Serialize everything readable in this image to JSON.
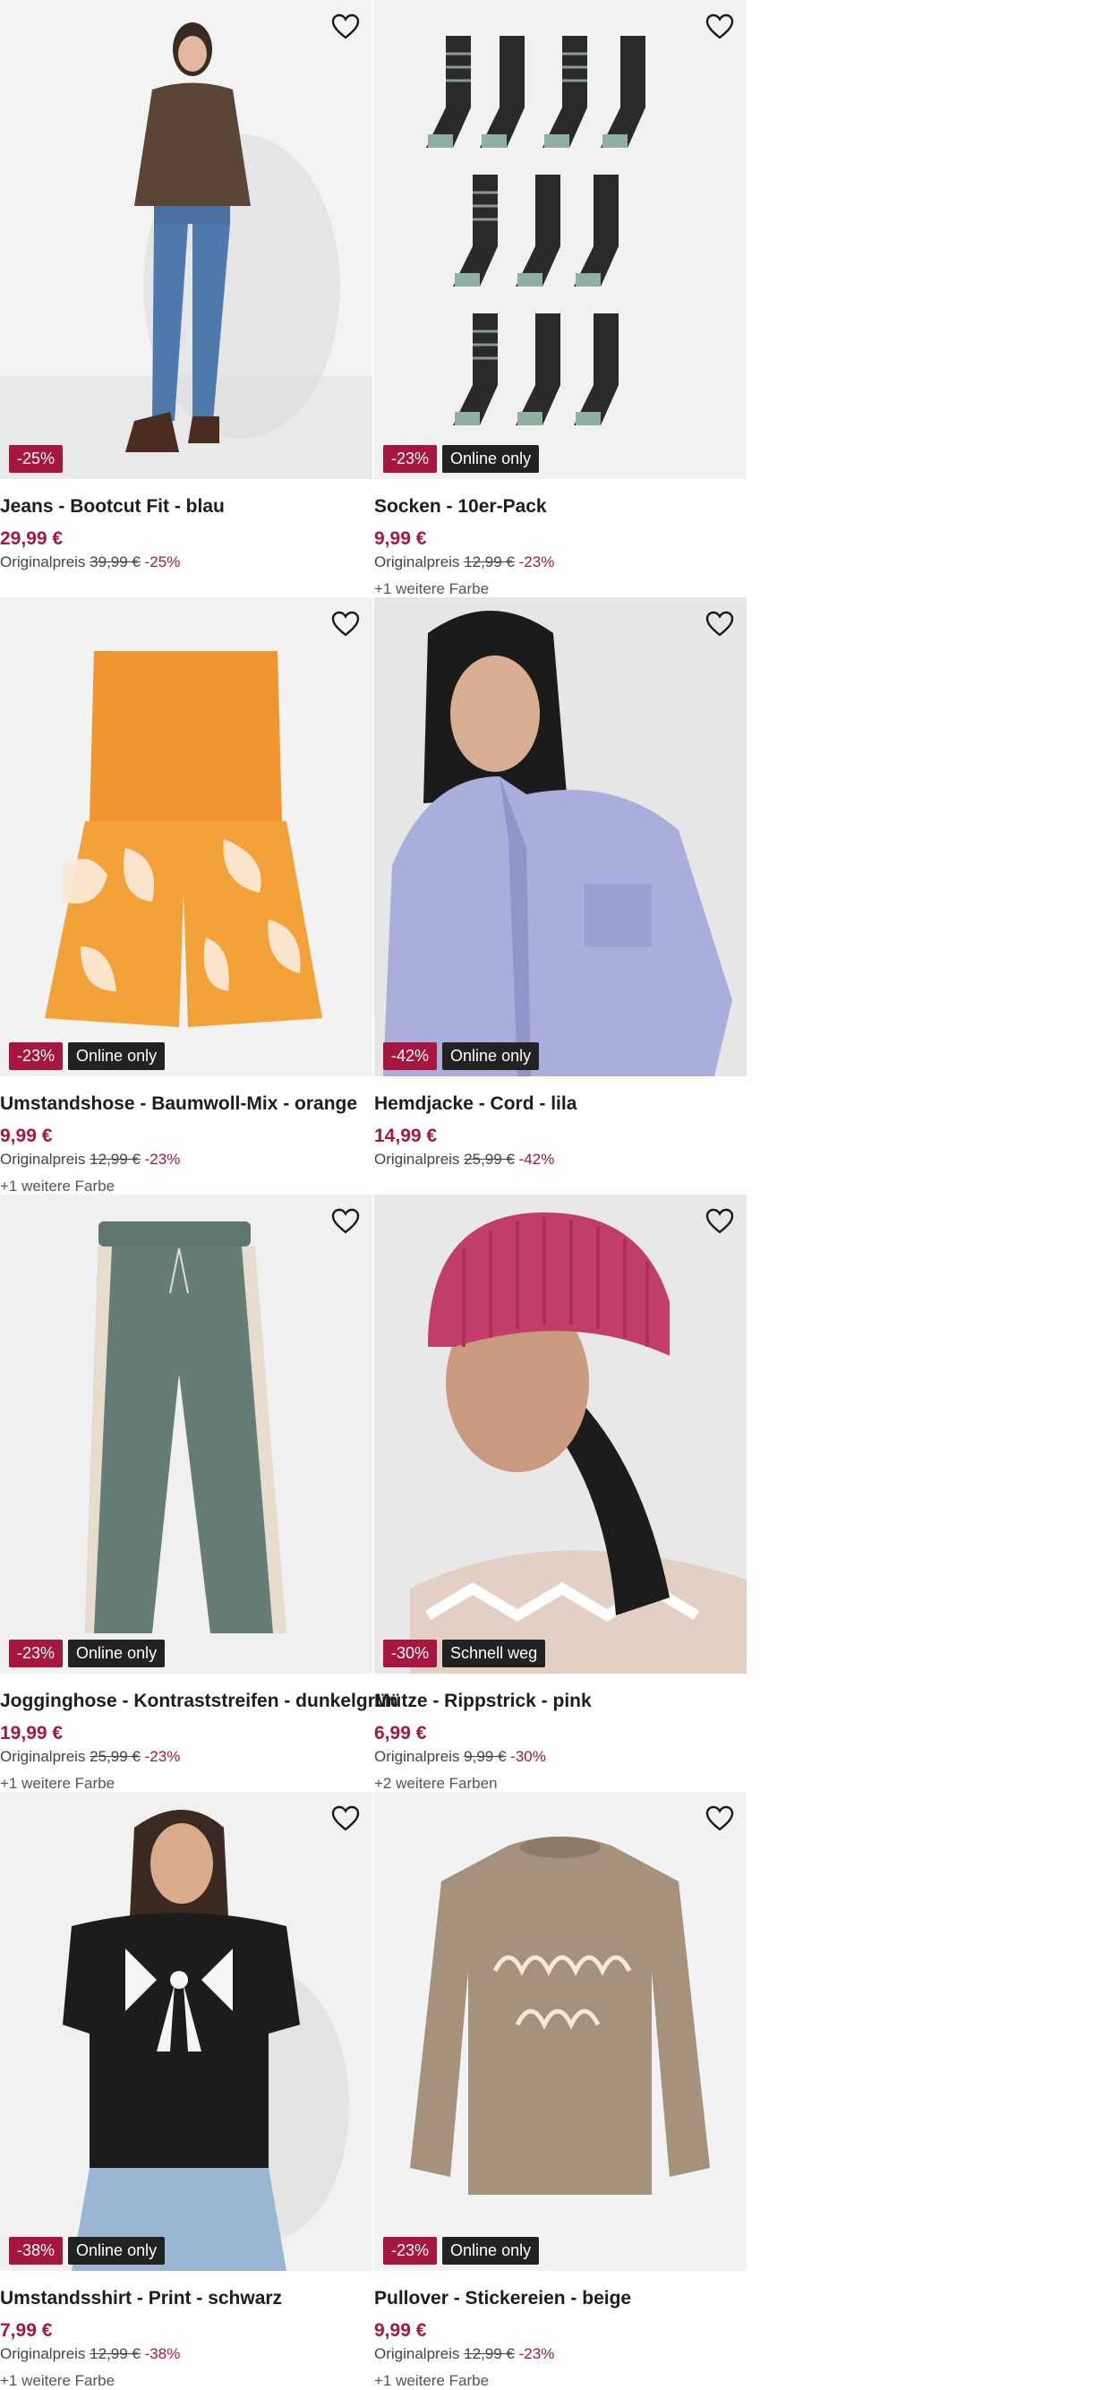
{
  "colors": {
    "discount": "#a6163f",
    "tag": "#222222"
  },
  "products": [
    {
      "title": "Jeans - Bootcut Fit - blau",
      "price": "29,99 €",
      "orig_label": "Originalpreis",
      "orig_price": "39,99 €",
      "orig_pct": "-25%",
      "discount_badge": "-25%",
      "tag": "",
      "more_colors": ""
    },
    {
      "title": "Socken - 10er-Pack",
      "price": "9,99 €",
      "orig_label": "Originalpreis",
      "orig_price": "12,99 €",
      "orig_pct": "-23%",
      "discount_badge": "-23%",
      "tag": "Online only",
      "more_colors": "+1 weitere Farbe"
    },
    {
      "title": "Umstandshose - Baumwoll-Mix - orange",
      "price": "9,99 €",
      "orig_label": "Originalpreis",
      "orig_price": "12,99 €",
      "orig_pct": "-23%",
      "discount_badge": "-23%",
      "tag": "Online only",
      "more_colors": "+1 weitere Farbe"
    },
    {
      "title": "Hemdjacke - Cord - lila",
      "price": "14,99 €",
      "orig_label": "Originalpreis",
      "orig_price": "25,99 €",
      "orig_pct": "-42%",
      "discount_badge": "-42%",
      "tag": "Online only",
      "more_colors": ""
    },
    {
      "title": "Jogginghose - Kontraststreifen - dunkelgrün",
      "price": "19,99 €",
      "orig_label": "Originalpreis",
      "orig_price": "25,99 €",
      "orig_pct": "-23%",
      "discount_badge": "-23%",
      "tag": "Online only",
      "more_colors": "+1 weitere Farbe"
    },
    {
      "title": "Mütze - Rippstrick - pink",
      "price": "6,99 €",
      "orig_label": "Originalpreis",
      "orig_price": "9,99 €",
      "orig_pct": "-30%",
      "discount_badge": "-30%",
      "tag": "Schnell weg",
      "more_colors": "+2 weitere Farben"
    },
    {
      "title": "Umstandsshirt - Print - schwarz",
      "price": "7,99 €",
      "orig_label": "Originalpreis",
      "orig_price": "12,99 €",
      "orig_pct": "-38%",
      "discount_badge": "-38%",
      "tag": "Online only",
      "more_colors": "+1 weitere Farbe"
    },
    {
      "title": "Pullover - Stickereien - beige",
      "price": "9,99 €",
      "orig_label": "Originalpreis",
      "orig_price": "12,99 €",
      "orig_pct": "-23%",
      "discount_badge": "-23%",
      "tag": "Online only",
      "more_colors": "+1 weitere Farbe"
    }
  ],
  "images": [
    {
      "name": "jeans-model-image"
    },
    {
      "name": "socks-pack-image"
    },
    {
      "name": "maternity-shorts-image"
    },
    {
      "name": "shirt-jacket-model-image"
    },
    {
      "name": "jogging-pants-image"
    },
    {
      "name": "beanie-model-image"
    },
    {
      "name": "maternity-shirt-model-image"
    },
    {
      "name": "sweater-image"
    }
  ]
}
